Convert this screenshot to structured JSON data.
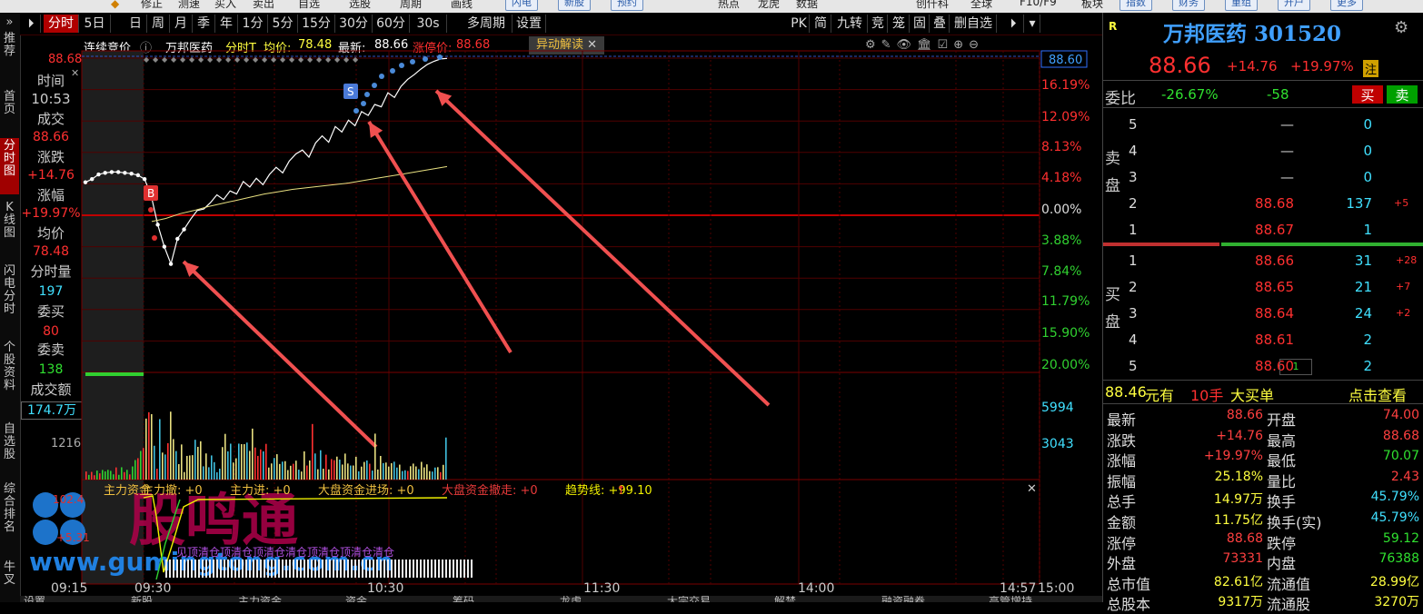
{
  "top_menu": [
    "修正",
    "测速",
    "买入",
    "卖出",
    "自选",
    "选股",
    "周期",
    "画线",
    "热点",
    "龙虎",
    "数据",
    "创仟科",
    "全球",
    "F10/F9",
    "板块"
  ],
  "top_buttons": [
    "闪电",
    "新股",
    "预约",
    "指数",
    "财务",
    "重组",
    "开户",
    "更多"
  ],
  "left_tabs": [
    "推荐",
    "首页",
    "分时图",
    "K线图",
    "闪电分时",
    "个股资料",
    "自选股",
    "综合排名",
    "牛叉"
  ],
  "toolbar": {
    "items": [
      "分时",
      "5日",
      "日",
      "周",
      "月",
      "季",
      "年",
      "1分",
      "5分",
      "15分",
      "30分",
      "60分",
      "30s",
      "多周期",
      "设置"
    ],
    "right_items": [
      "PK",
      "简",
      "九转",
      "竞",
      "笼",
      "固",
      "叠",
      "删自选"
    ]
  },
  "chart_header": {
    "mode": "连续竞价",
    "stock_name": "万邦医药",
    "label": "分时T",
    "avg_label": "均价:",
    "avg_value": "78.48",
    "latest_label": "最新:",
    "latest_value": "88.66",
    "limit_label": "涨停价:",
    "limit_value": "88.68",
    "anomaly_button": "异动解读",
    "price_tag": "88.60",
    "top_left_price": "88.68"
  },
  "sidebar": {
    "time_label": "时间",
    "time_value": "10:53",
    "trade_label": "成交",
    "trade_value": "88.66",
    "chg_label": "涨跌",
    "chg_value": "+14.76",
    "pct_label": "涨幅",
    "pct_value": "+19.97%",
    "avg_label": "均价",
    "avg_value": "78.48",
    "vol_label": "分时量",
    "vol_value": "197",
    "bid_label": "委买",
    "bid_value": "80",
    "ask_label": "委卖",
    "ask_value": "138",
    "amt_label": "成交额",
    "amt_value": "174.7万",
    "vol_axis_label": "1216"
  },
  "chart_data": {
    "type": "line",
    "x_ticks": [
      "09:15",
      "09:30",
      "10:30",
      "11:30",
      "14:00",
      "14:57",
      "15:00"
    ],
    "y_ticks_pct": [
      "16.19%",
      "12.09%",
      "8.13%",
      "4.18%",
      "0.00%",
      "3.88%",
      "7.84%",
      "11.79%",
      "15.90%",
      "20.00%"
    ],
    "volume_ticks": [
      "5994",
      "3043"
    ],
    "ylim_pct": [
      -20,
      20
    ],
    "prev_close": 73.9,
    "limit_up": 88.68,
    "price_pct": [
      4.2,
      4.6,
      5.2,
      5.4,
      5.5,
      5.5,
      5.4,
      5.3,
      5.1,
      4.6,
      2.5,
      -1.2,
      -4.0,
      -6.2,
      -3.0,
      -1.8,
      -0.5,
      0.6,
      0.8,
      1.6,
      2.6,
      2.0,
      3.1,
      2.7,
      4.3,
      3.6,
      4.7,
      3.9,
      5.2,
      6.1,
      5.4,
      6.9,
      7.8,
      8.3,
      7.4,
      9.2,
      10.1,
      9.3,
      11.3,
      10.6,
      12.1,
      11.4,
      13.2,
      12.7,
      14.1,
      13.8,
      15.6,
      15.0,
      16.4,
      17.3,
      17.9,
      18.6,
      19.2,
      19.6,
      19.9,
      19.97
    ],
    "avg_pct": [
      -0.8,
      -0.4,
      0.2,
      0.6,
      1.1,
      1.5,
      1.9,
      2.3,
      2.7,
      3.0,
      3.3,
      3.5,
      3.7,
      3.9,
      4.1,
      4.4,
      4.7,
      5.0,
      5.3,
      5.6,
      5.9,
      6.2
    ],
    "buy_marker": "B",
    "sell_marker": "S"
  },
  "indicator": {
    "items": [
      {
        "text": "主力资金",
        "color": "#f0c040"
      },
      {
        "text": "主力撤: +0",
        "color": "#f0c040"
      },
      {
        "text": "主力进: +0",
        "color": "#f0c040"
      },
      {
        "text": "大盘资金进场: +0",
        "color": "#f0c040"
      },
      {
        "text": "大盘资金撤走: +0",
        "color": "#e83a3a"
      },
      {
        "text": "趋势线: +99.10",
        "color": "#f0f000"
      }
    ],
    "val1": "102.4",
    "val2": "+5.31",
    "watermark_name": "股鸣通",
    "watermark_url": "www.gumingtong.com.cn",
    "purple_text": "见顶清仓顶清仓顶清仓清仓顶清仓顶清仓清仓"
  },
  "right": {
    "header_mark": "R",
    "stock_title": "万邦医药 301520",
    "price": "88.66",
    "chg": "+14.76",
    "pct": "+19.97%",
    "tag": "注",
    "wb_label": "委比",
    "wb_value": "-26.67%",
    "wb_diff": "-58",
    "buy_btn": "买",
    "sell_btn": "卖",
    "sell_label": "卖盘",
    "buy_label": "买盘",
    "sell_rows": [
      {
        "lvl": "5",
        "price": "—",
        "vol": "0",
        "chg": ""
      },
      {
        "lvl": "4",
        "price": "—",
        "vol": "0",
        "chg": ""
      },
      {
        "lvl": "3",
        "price": "—",
        "vol": "0",
        "chg": ""
      },
      {
        "lvl": "2",
        "price": "88.68",
        "vol": "137",
        "chg": "+5"
      },
      {
        "lvl": "1",
        "price": "88.67",
        "vol": "1",
        "chg": ""
      }
    ],
    "buy_rows": [
      {
        "lvl": "1",
        "price": "88.66",
        "vol": "31",
        "chg": "+28"
      },
      {
        "lvl": "2",
        "price": "88.65",
        "vol": "21",
        "chg": "+7"
      },
      {
        "lvl": "3",
        "price": "88.64",
        "vol": "24",
        "chg": "+2"
      },
      {
        "lvl": "4",
        "price": "88.61",
        "vol": "2",
        "chg": ""
      },
      {
        "lvl": "5",
        "price": "88.60",
        "vol": "2",
        "chg": "",
        "box": "1"
      }
    ],
    "bigorder_price": "88.46",
    "bigorder_a": "元有",
    "bigorder_vol": "10手",
    "bigorder_b": "大买单",
    "bigorder_link": "点击查看",
    "stats": [
      {
        "l": "最新",
        "v": "88.66",
        "vc": "#ff4040",
        "l2": "开盘",
        "v2": "74.00",
        "v2c": "#ff4040"
      },
      {
        "l": "涨跌",
        "v": "+14.76",
        "vc": "#ff4040",
        "l2": "最高",
        "v2": "88.68",
        "v2c": "#ff4040"
      },
      {
        "l": "涨幅",
        "v": "+19.97%",
        "vc": "#ff4040",
        "l2": "最低",
        "v2": "70.07",
        "v2c": "#30e030"
      },
      {
        "l": "振幅",
        "v": "25.18%",
        "vc": "#ffff40",
        "l2": "量比",
        "v2": "2.43",
        "v2c": "#ff4040"
      },
      {
        "l": "总手",
        "v": "14.97万",
        "vc": "#ffff40",
        "l2": "换手",
        "v2": "45.79%",
        "v2c": "#40e0ff"
      },
      {
        "l": "金额",
        "v": "11.75亿",
        "vc": "#ffff40",
        "l2": "换手(实)",
        "v2": "45.79%",
        "v2c": "#40e0ff"
      },
      {
        "l": "涨停",
        "v": "88.68",
        "vc": "#ff4040",
        "l2": "跌停",
        "v2": "59.12",
        "v2c": "#30e030"
      },
      {
        "l": "外盘",
        "v": "73331",
        "vc": "#ff4040",
        "l2": "内盘",
        "v2": "76388",
        "v2c": "#30e030"
      },
      {
        "l": "总市值",
        "v": "82.61亿",
        "vc": "#ffff40",
        "l2": "流通值",
        "v2": "28.99亿",
        "v2c": "#ffff40"
      },
      {
        "l": "总股本",
        "v": "9317万",
        "vc": "#ffff40",
        "l2": "流通股",
        "v2": "3270万",
        "v2c": "#ffff40"
      }
    ]
  },
  "bottom_tabs": [
    "设置",
    "新股",
    "主力资金",
    "资金",
    "筹码",
    "龙虎",
    "大宗交易",
    "解禁",
    "融资融券",
    "高管增持"
  ],
  "colors": {
    "red": "#ff3030",
    "green": "#30d030",
    "yellow": "#ffff40",
    "cyan": "#40e0ff",
    "grid": "#5a0000",
    "accent": "#b00000"
  }
}
